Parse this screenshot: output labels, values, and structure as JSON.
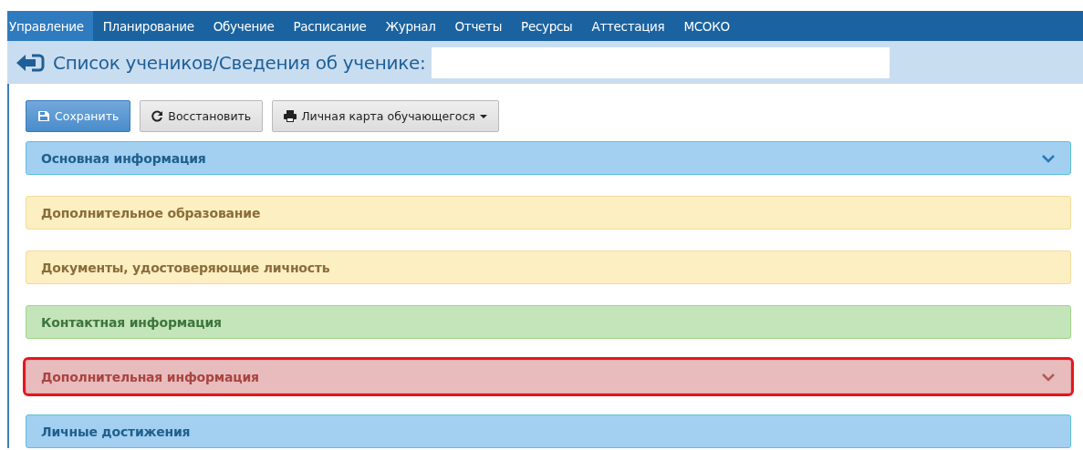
{
  "menu": [
    {
      "label": "Управление",
      "selected": true
    },
    {
      "label": "Планирование",
      "selected": false
    },
    {
      "label": "Обучение",
      "selected": false
    },
    {
      "label": "Расписание",
      "selected": false
    },
    {
      "label": "Журнал",
      "selected": false
    },
    {
      "label": "Отчеты",
      "selected": false
    },
    {
      "label": "Ресурсы",
      "selected": false
    },
    {
      "label": "Аттестация",
      "selected": false
    },
    {
      "label": "МСОКО",
      "selected": false
    }
  ],
  "header": {
    "title": "Список учеников/Сведения об ученике:"
  },
  "buttons": [
    {
      "label": "Сохранить",
      "kind": "save"
    },
    {
      "label": "Восстановить",
      "kind": "restore"
    },
    {
      "label": "Личная карта обучающегося",
      "kind": "print"
    }
  ],
  "panels": [
    {
      "title": "Основная информация",
      "kind": "info",
      "chevron": true,
      "highlighted": false
    },
    {
      "title": "Дополнительное образование",
      "kind": "warning",
      "chevron": false,
      "highlighted": false
    },
    {
      "title": "Документы, удостоверяющие личность",
      "kind": "warning",
      "chevron": false,
      "highlighted": false
    },
    {
      "title": "Контактная информация",
      "kind": "success",
      "chevron": false,
      "highlighted": false
    },
    {
      "title": "Дополнительная информация",
      "kind": "danger",
      "chevron": true,
      "highlighted": true
    },
    {
      "title": "Личные достижения",
      "kind": "info",
      "chevron": false,
      "highlighted": false
    }
  ]
}
